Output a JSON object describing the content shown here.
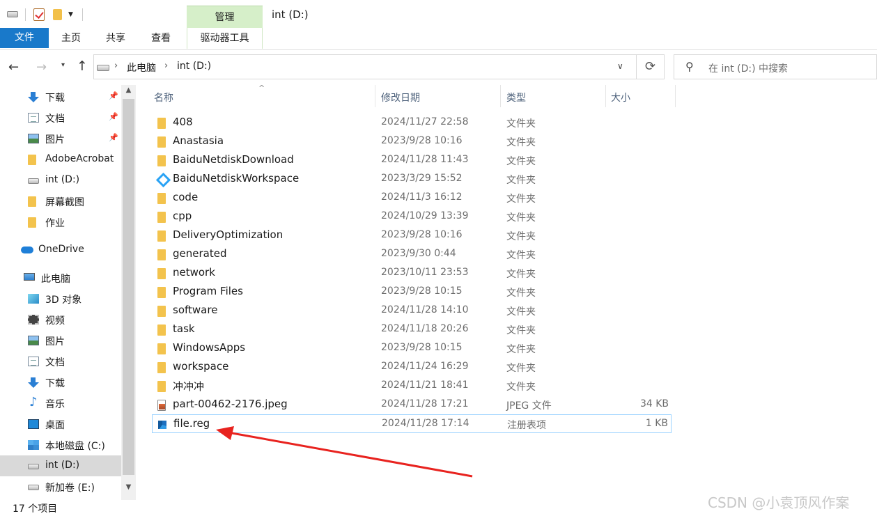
{
  "window": {
    "title": "int (D:)"
  },
  "ribbon": {
    "context_group": "管理",
    "tabs": [
      "文件",
      "主页",
      "共享",
      "查看",
      "驱动器工具"
    ]
  },
  "address": {
    "crumbs": [
      "此电脑",
      "int (D:)"
    ],
    "search_placeholder": "在 int (D:) 中搜索"
  },
  "nav": {
    "items": [
      {
        "label": "下载",
        "icon": "download-icon",
        "pinned": true
      },
      {
        "label": "文档",
        "icon": "document-icon",
        "pinned": true
      },
      {
        "label": "图片",
        "icon": "pictures-icon",
        "pinned": true
      },
      {
        "label": "AdobeAcrobat",
        "icon": "folder-icon",
        "pinned": false
      },
      {
        "label": "int (D:)",
        "icon": "drive-icon",
        "pinned": false
      },
      {
        "label": "屏幕截图",
        "icon": "folder-icon",
        "pinned": false
      },
      {
        "label": "作业",
        "icon": "folder-icon",
        "pinned": false
      },
      {
        "label": "OneDrive",
        "icon": "onedrive-icon",
        "pinned": false
      },
      {
        "label": "此电脑",
        "icon": "computer-icon",
        "pinned": false
      },
      {
        "label": "3D 对象",
        "icon": "3d-objects-icon",
        "pinned": false
      },
      {
        "label": "视频",
        "icon": "video-icon",
        "pinned": false
      },
      {
        "label": "图片",
        "icon": "pictures-icon",
        "pinned": false
      },
      {
        "label": "文档",
        "icon": "document-icon",
        "pinned": false
      },
      {
        "label": "下载",
        "icon": "download-icon",
        "pinned": false
      },
      {
        "label": "音乐",
        "icon": "music-icon",
        "pinned": false
      },
      {
        "label": "桌面",
        "icon": "desktop-icon",
        "pinned": false
      },
      {
        "label": "本地磁盘 (C:)",
        "icon": "windows-drive-icon",
        "pinned": false
      },
      {
        "label": "int (D:)",
        "icon": "drive-icon",
        "pinned": false,
        "selected": true
      },
      {
        "label": "新加卷 (E:)",
        "icon": "drive-icon",
        "pinned": false
      }
    ]
  },
  "columns": {
    "name": "名称",
    "date": "修改日期",
    "type": "类型",
    "size": "大小"
  },
  "files": [
    {
      "name": "408",
      "date": "2024/11/27 22:58",
      "type": "文件夹",
      "size": "",
      "icon": "folder-icon"
    },
    {
      "name": "Anastasia",
      "date": "2023/9/28 10:16",
      "type": "文件夹",
      "size": "",
      "icon": "folder-icon"
    },
    {
      "name": "BaiduNetdiskDownload",
      "date": "2024/11/28 11:43",
      "type": "文件夹",
      "size": "",
      "icon": "folder-icon"
    },
    {
      "name": "BaiduNetdiskWorkspace",
      "date": "2023/3/29 15:52",
      "type": "文件夹",
      "size": "",
      "icon": "baidu-netdisk-icon"
    },
    {
      "name": "code",
      "date": "2024/11/3 16:12",
      "type": "文件夹",
      "size": "",
      "icon": "folder-icon"
    },
    {
      "name": "cpp",
      "date": "2024/10/29 13:39",
      "type": "文件夹",
      "size": "",
      "icon": "folder-icon"
    },
    {
      "name": "DeliveryOptimization",
      "date": "2023/9/28 10:16",
      "type": "文件夹",
      "size": "",
      "icon": "folder-icon"
    },
    {
      "name": "generated",
      "date": "2023/9/30 0:44",
      "type": "文件夹",
      "size": "",
      "icon": "folder-icon"
    },
    {
      "name": "network",
      "date": "2023/10/11 23:53",
      "type": "文件夹",
      "size": "",
      "icon": "folder-icon"
    },
    {
      "name": "Program Files",
      "date": "2023/9/28 10:15",
      "type": "文件夹",
      "size": "",
      "icon": "folder-icon"
    },
    {
      "name": "software",
      "date": "2024/11/28 14:10",
      "type": "文件夹",
      "size": "",
      "icon": "folder-icon"
    },
    {
      "name": "task",
      "date": "2024/11/18 20:26",
      "type": "文件夹",
      "size": "",
      "icon": "folder-icon"
    },
    {
      "name": "WindowsApps",
      "date": "2023/9/28 10:15",
      "type": "文件夹",
      "size": "",
      "icon": "folder-icon"
    },
    {
      "name": "workspace",
      "date": "2024/11/24 16:29",
      "type": "文件夹",
      "size": "",
      "icon": "folder-icon"
    },
    {
      "name": "冲冲冲",
      "date": "2024/11/21 18:41",
      "type": "文件夹",
      "size": "",
      "icon": "folder-icon"
    },
    {
      "name": "part-00462-2176.jpeg",
      "date": "2024/11/28 17:21",
      "type": "JPEG 文件",
      "size": "34 KB",
      "icon": "jpeg-file-icon"
    },
    {
      "name": "file.reg",
      "date": "2024/11/28 17:14",
      "type": "注册表项",
      "size": "1 KB",
      "icon": "registry-file-icon",
      "selected": true
    }
  ],
  "status": {
    "item_count": "17 个项目"
  },
  "watermark": "CSDN @小袁顶风作案",
  "colors": {
    "accent": "#1979ca",
    "selection_border": "#99d1ff",
    "annotation_arrow": "#e8231f"
  }
}
